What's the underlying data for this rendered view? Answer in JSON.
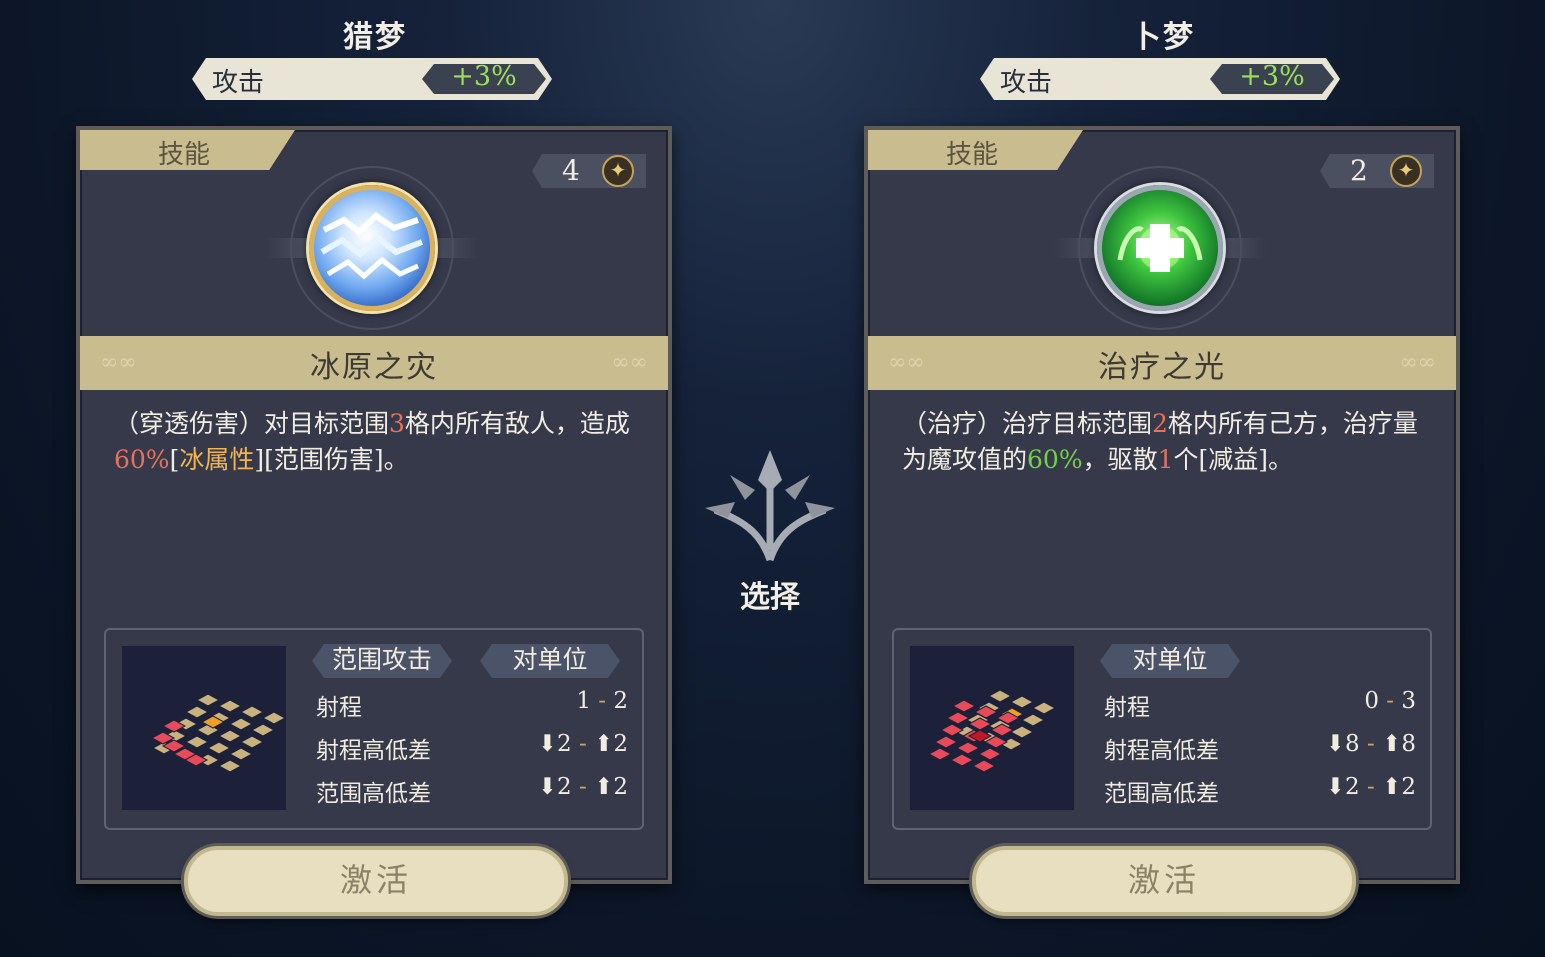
{
  "left": {
    "character": "猎梦",
    "stat": {
      "label": "攻击",
      "value": "+3%"
    },
    "tab": "技能",
    "cost": "4",
    "icon": "ice-shard-icon",
    "skill_name": "冰原之灾",
    "desc": {
      "p1": "（穿透伤害）对目标范围",
      "n1": "3",
      "p2": "格内所有敌人，造成",
      "n2": "60%",
      "p3": "[",
      "elem": "冰属性",
      "p4": "][范围伤害]。"
    },
    "tags": [
      "范围攻击",
      "对单位"
    ],
    "rows": [
      {
        "k": "射程",
        "a": "1",
        "sep": "-",
        "b": "2"
      },
      {
        "k": "射程高低差",
        "a": "⬇2",
        "sep": "-",
        "b": "⬆2"
      },
      {
        "k": "范围高低差",
        "a": "⬇2",
        "sep": "-",
        "b": "⬆2"
      }
    ],
    "button": "激活"
  },
  "right": {
    "character": "卜梦",
    "stat": {
      "label": "攻击",
      "value": "+3%"
    },
    "tab": "技能",
    "cost": "2",
    "icon": "heal-cross-icon",
    "skill_name": "治疗之光",
    "desc": {
      "p1": "（治疗）治疗目标范围",
      "n1": "2",
      "p2": "格内所有己方，治疗量为魔攻值的",
      "n2": "60%",
      "p3": "，驱散",
      "n3": "1",
      "p4": "个[减益]。"
    },
    "tags": [
      "对单位"
    ],
    "rows": [
      {
        "k": "射程",
        "a": "0",
        "sep": "-",
        "b": "3"
      },
      {
        "k": "射程高低差",
        "a": "⬇8",
        "sep": "-",
        "b": "⬆8"
      },
      {
        "k": "范围高低差",
        "a": "⬇2",
        "sep": "-",
        "b": "⬆2"
      }
    ],
    "button": "激活"
  },
  "center": {
    "label": "选择",
    "icon": "tree-emblem-icon"
  },
  "colors": {
    "number_red": "#e8705e",
    "element_gold": "#f2b552",
    "heal_green": "#74d04a",
    "stat_green": "#9ee05a"
  }
}
